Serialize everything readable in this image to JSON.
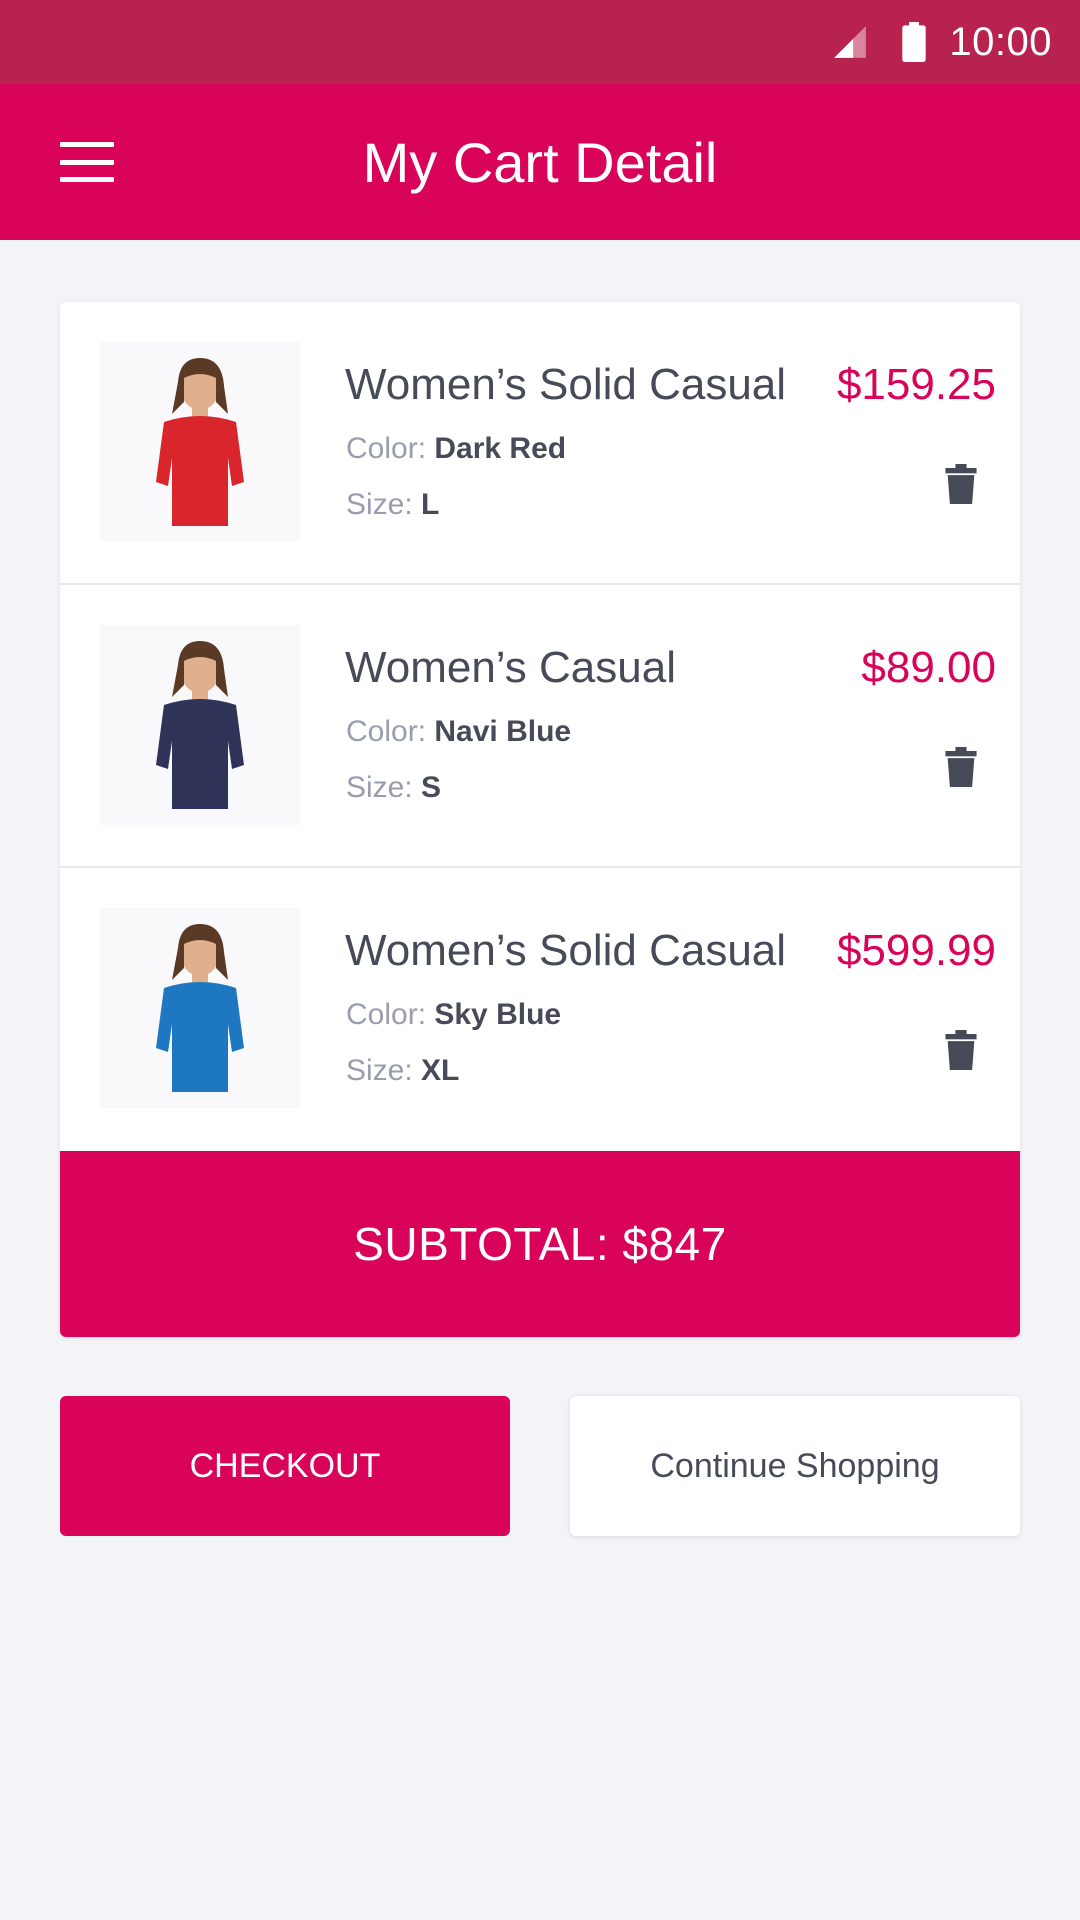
{
  "status_bar": {
    "time": "10:00"
  },
  "app_bar": {
    "title": "My Cart Detail"
  },
  "cart": {
    "items": [
      {
        "name": "Women’s Solid Casual",
        "price": "$159.25",
        "color_label": "Color:",
        "color_value": "Dark Red",
        "size_label": "Size:",
        "size_value": "L",
        "shirt_color": "#d8262c"
      },
      {
        "name": "Women’s Casual",
        "price": "$89.00",
        "color_label": "Color:",
        "color_value": "Navi Blue",
        "size_label": "Size:",
        "size_value": "S",
        "shirt_color": "#2f3358"
      },
      {
        "name": "Women’s Solid Casual",
        "price": "$599.99",
        "color_label": "Color:",
        "color_value": "Sky Blue",
        "size_label": "Size:",
        "size_value": "XL",
        "shirt_color": "#1d78c1"
      }
    ],
    "subtotal": "SUBTOTAL: $847"
  },
  "actions": {
    "checkout_label": "CHECKOUT",
    "continue_label": "Continue Shopping"
  },
  "icons": {
    "menu": "hamburger-menu-icon",
    "delete": "trash-icon",
    "signal": "cell-signal-icon",
    "battery": "battery-icon"
  },
  "colors": {
    "status_bar": "#b8224e",
    "accent": "#d9045a",
    "background": "#f3f4f8"
  }
}
